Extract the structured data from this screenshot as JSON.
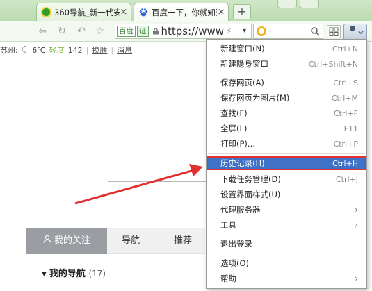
{
  "browser": {
    "tabs": [
      {
        "title": "360导航_新一代安",
        "favicon": "360-logo-icon"
      },
      {
        "title": "百度一下，你就知道",
        "favicon": "baidu-paw-icon"
      }
    ],
    "new_tab_label": "+",
    "close_glyph": "×"
  },
  "address_bar": {
    "site_chip": "百度",
    "cert_chip": "证",
    "url": "https://www",
    "bolt_glyph": "⚡",
    "dropdown_glyph": "▾"
  },
  "info_bar": {
    "city": "苏州:",
    "temperature": "6℃",
    "air_quality_label": "轻度",
    "air_quality_value": "142",
    "skin_link": "换肤",
    "message_link": "消息",
    "separator": "|"
  },
  "page": {
    "tabs": [
      "我的关注",
      "导航",
      "推荐"
    ],
    "my_nav_label": "我的导航",
    "my_nav_count": "(17)"
  },
  "menu": {
    "items": [
      {
        "label": "新建窗口(N)",
        "shortcut": "Ctrl+N"
      },
      {
        "label": "新建隐身窗口",
        "shortcut": "Ctrl+Shift+N"
      },
      {
        "label": "保存网页(A)",
        "shortcut": "Ctrl+S"
      },
      {
        "label": "保存网页为图片(M)",
        "shortcut": "Ctrl+M"
      },
      {
        "label": "查找(F)",
        "shortcut": "Ctrl+F"
      },
      {
        "label": "全屏(L)",
        "shortcut": "F11"
      },
      {
        "label": "打印(P)...",
        "shortcut": "Ctrl+P"
      },
      {
        "label": "历史记录(H)",
        "shortcut": "Ctrl+H"
      },
      {
        "label": "下载任务管理(D)",
        "shortcut": "Ctrl+J"
      },
      {
        "label": "设置界面样式(U)",
        "shortcut": ""
      },
      {
        "label": "代理服务器",
        "shortcut": ""
      },
      {
        "label": "工具",
        "shortcut": ""
      },
      {
        "label": "退出登录",
        "shortcut": ""
      },
      {
        "label": "选项(O)",
        "shortcut": ""
      },
      {
        "label": "帮助",
        "shortcut": ""
      }
    ],
    "submenu_glyph": "›"
  },
  "colors": {
    "menu_highlight": "#3f72c6",
    "annotation_red": "#e0302f",
    "tabstrip_green": "#bcdcb1"
  }
}
